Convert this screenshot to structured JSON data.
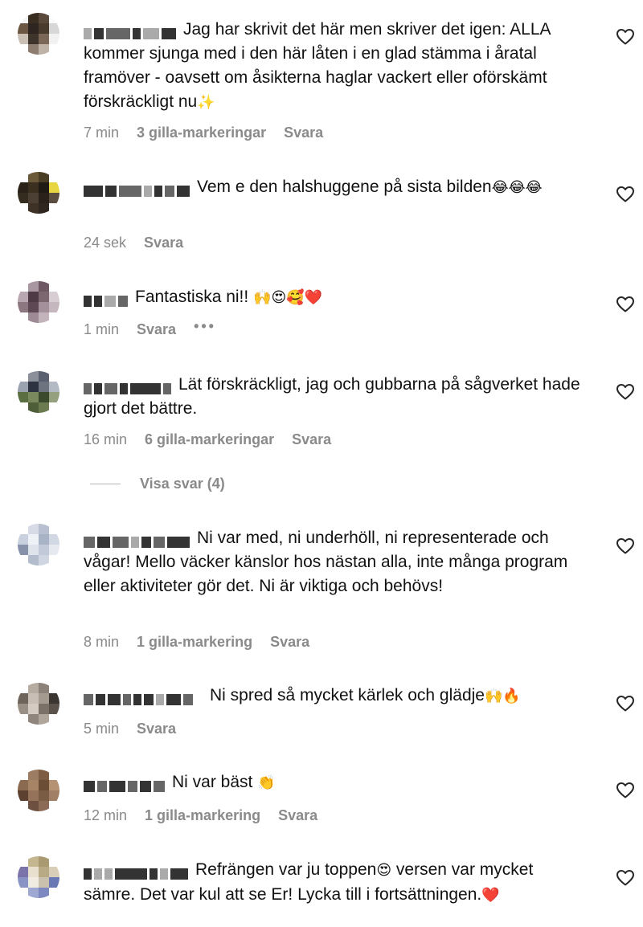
{
  "comments": [
    {
      "text": "Jag har skrivit det här men skriver det igen: ALLA kommer sjunga med i den här låten i en glad stämma i åratal framöver - oavsett om åsikterna haglar vackert eller oförskämt förskräckligt nu",
      "emoji": "✨",
      "time": "7 min",
      "likes": "3 gilla-markeringar",
      "reply": "Svara"
    },
    {
      "text": "Vem e den halshuggene på sista bilden",
      "emoji": "😂😂😂",
      "time": "24 sek",
      "likes": "",
      "reply": "Svara"
    },
    {
      "text": "Fantastiska ni!!",
      "emoji": "🙌😍🥰❤️",
      "time": "1 min",
      "likes": "",
      "reply": "Svara",
      "more": "•••"
    },
    {
      "text": "Lät förskräckligt, jag och gubbarna på sågverket hade gjort det bättre.",
      "emoji": "",
      "time": "16 min",
      "likes": "6 gilla-markeringar",
      "reply": "Svara"
    },
    {
      "text": "Ni var med, ni underhöll, ni representerade och vågar! Mello väcker känslor hos nästan alla, inte många program eller aktiviteter gör det. Ni är viktiga och behövs!",
      "emoji": "",
      "time": "8 min",
      "likes": "1 gilla-markering",
      "reply": "Svara"
    },
    {
      "text": "Ni spred så mycket kärlek och glädje",
      "emoji": "🙌🔥",
      "time": "5 min",
      "likes": "",
      "reply": "Svara"
    },
    {
      "text": "Ni var bäst",
      "emoji": "👏",
      "time": "12 min",
      "likes": "1 gilla-markering",
      "reply": "Svara"
    },
    {
      "text": "Refrängen var ju toppen",
      "emoji": "😍",
      "text2": " versen var mycket sämre. Det var kul att se Er! Lycka till i fortsättningen.",
      "emoji2": "❤️"
    }
  ],
  "view_replies": "Visa svar (4)",
  "colors": {
    "meta": "#8a8a8a",
    "text": "#111111",
    "heart_outline": "#262626"
  },
  "icons": {
    "heart": "heart-outline-icon",
    "avatar": "pixelated-avatar"
  }
}
